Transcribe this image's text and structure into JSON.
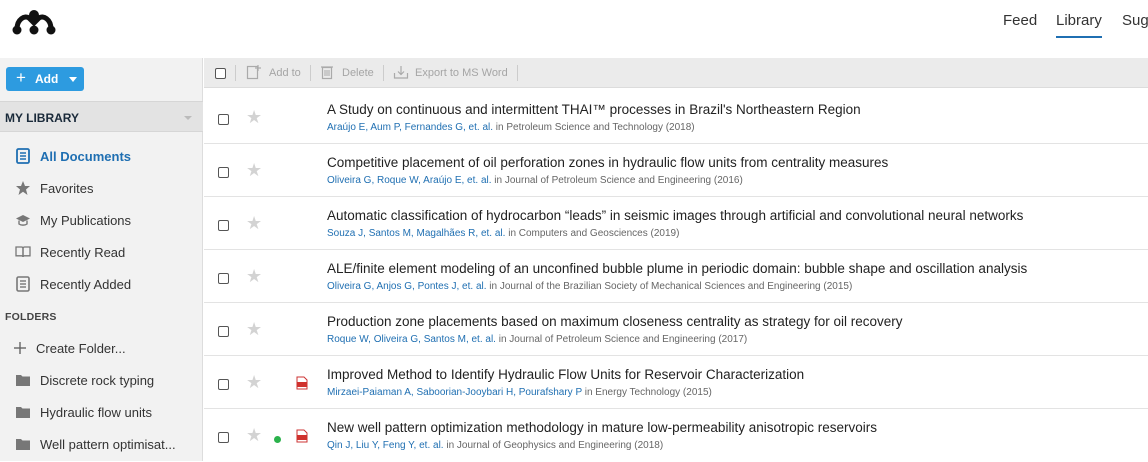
{
  "nav": {
    "feed": "Feed",
    "library": "Library",
    "suggest": "Sug"
  },
  "sidebar": {
    "add_label": "Add",
    "my_library": "MY LIBRARY",
    "items": [
      {
        "label": "All Documents",
        "icon": "all-documents-icon",
        "active": true
      },
      {
        "label": "Favorites",
        "icon": "star-icon"
      },
      {
        "label": "My Publications",
        "icon": "graduation-cap-icon"
      },
      {
        "label": "Recently Read",
        "icon": "open-book-icon"
      },
      {
        "label": "Recently Added",
        "icon": "recently-added-icon"
      }
    ],
    "folders_heading": "FOLDERS",
    "create_folder": "Create Folder...",
    "folders": [
      {
        "label": "Discrete rock typing"
      },
      {
        "label": "Hydraulic flow units"
      },
      {
        "label": "Well pattern optimisat..."
      }
    ]
  },
  "toolbar": {
    "add_to": "Add to",
    "delete": "Delete",
    "export": "Export to MS Word"
  },
  "documents": [
    {
      "title": "A Study on continuous and intermittent THAI™ processes in Brazil's Northeastern Region",
      "authors": "Araújo E, Aum P, Fernandes G, et. al.",
      "source": " in Petroleum Science and Technology (2018)",
      "pdf": false,
      "dot": false
    },
    {
      "title": "Competitive placement of oil perforation zones in hydraulic flow units from centrality measures",
      "authors": "Oliveira G, Roque W, Araújo E, et. al.",
      "source": " in Journal of Petroleum Science and Engineering (2016)",
      "pdf": false,
      "dot": false
    },
    {
      "title": "Automatic classification of hydrocarbon “leads” in seismic images through artificial and convolutional neural networks",
      "authors": "Souza J, Santos M, Magalhães R, et. al.",
      "source": " in Computers and Geosciences (2019)",
      "pdf": false,
      "dot": false
    },
    {
      "title": "ALE/finite element modeling of an unconfined bubble plume in periodic domain: bubble shape and oscillation analysis",
      "authors": "Oliveira G, Anjos G, Pontes J, et. al.",
      "source": " in Journal of the Brazilian Society of Mechanical Sciences and Engineering (2015)",
      "pdf": false,
      "dot": false
    },
    {
      "title": "Production zone placements based on maximum closeness centrality as strategy for oil recovery",
      "authors": "Roque W, Oliveira G, Santos M, et. al.",
      "source": " in Journal of Petroleum Science and Engineering (2017)",
      "pdf": false,
      "dot": false
    },
    {
      "title": "Improved Method to Identify Hydraulic Flow Units for Reservoir Characterization",
      "authors": "Mirzaei-Paiaman A, Saboorian-Jooybari H, Pourafshary P",
      "source": " in Energy Technology (2015)",
      "pdf": true,
      "dot": false
    },
    {
      "title": "New well pattern optimization methodology in mature low-permeability anisotropic reservoirs",
      "authors": "Qin J, Liu Y, Feng Y, et. al.",
      "source": " in Journal of Geophysics and Engineering (2018)",
      "pdf": true,
      "dot": true
    }
  ],
  "colors": {
    "accent": "#1f6fb2",
    "add_button": "#2d9be0",
    "unread_dot": "#2bb24c",
    "pdf_red": "#d0312d"
  }
}
